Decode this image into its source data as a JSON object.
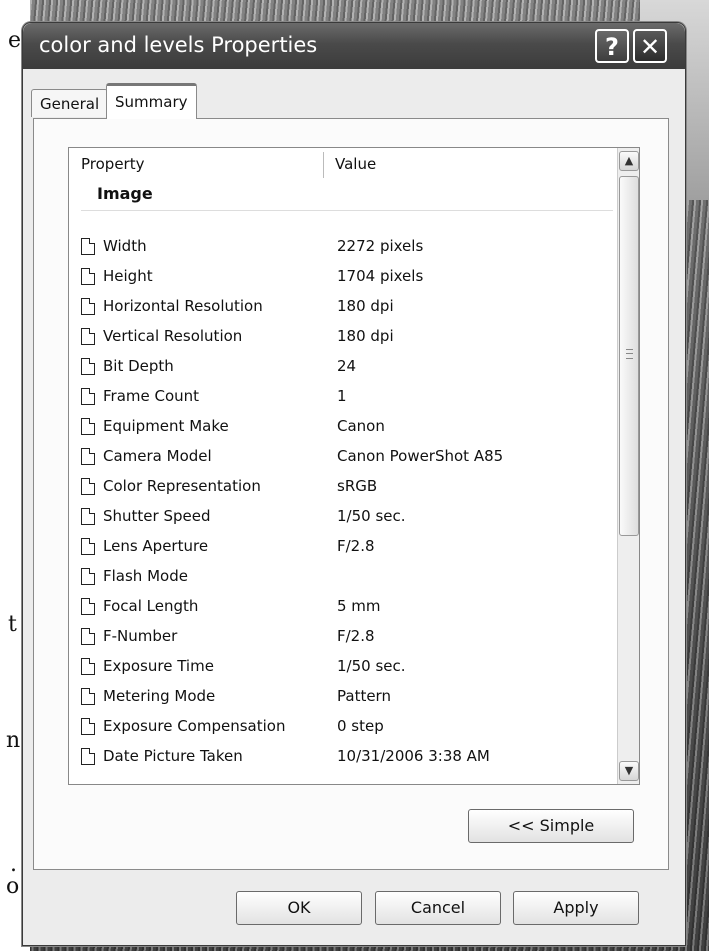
{
  "background": {
    "margin_text": [
      "e",
      "t",
      "n",
      ".",
      "o"
    ]
  },
  "window": {
    "title": "color and levels Properties",
    "help_glyph": "?",
    "close_glyph": "✕"
  },
  "tabs": [
    {
      "label": "General",
      "selected": false
    },
    {
      "label": "Summary",
      "selected": true
    }
  ],
  "list": {
    "columns": [
      "Property",
      "Value"
    ],
    "group": "Image",
    "rows": [
      {
        "property": "Width",
        "value": "2272 pixels"
      },
      {
        "property": "Height",
        "value": "1704 pixels"
      },
      {
        "property": "Horizontal Resolution",
        "value": "180 dpi"
      },
      {
        "property": "Vertical Resolution",
        "value": "180 dpi"
      },
      {
        "property": "Bit Depth",
        "value": "24"
      },
      {
        "property": "Frame Count",
        "value": "1"
      },
      {
        "property": "Equipment Make",
        "value": "Canon"
      },
      {
        "property": "Camera Model",
        "value": "Canon PowerShot A85"
      },
      {
        "property": "Color Representation",
        "value": "sRGB"
      },
      {
        "property": "Shutter Speed",
        "value": "1/50 sec."
      },
      {
        "property": "Lens Aperture",
        "value": "F/2.8"
      },
      {
        "property": "Flash Mode",
        "value": ""
      },
      {
        "property": "Focal Length",
        "value": "5 mm"
      },
      {
        "property": "F-Number",
        "value": "F/2.8"
      },
      {
        "property": "Exposure Time",
        "value": "1/50 sec."
      },
      {
        "property": "Metering Mode",
        "value": "Pattern"
      },
      {
        "property": "Exposure Compensation",
        "value": "0 step"
      },
      {
        "property": "Date Picture Taken",
        "value": "10/31/2006 3:38 AM"
      }
    ],
    "scroll_up_glyph": "▲",
    "scroll_down_glyph": "▼",
    "row_icon": "document-icon"
  },
  "buttons": {
    "simple": "<< Simple",
    "ok": "OK",
    "cancel": "Cancel",
    "apply": "Apply"
  }
}
